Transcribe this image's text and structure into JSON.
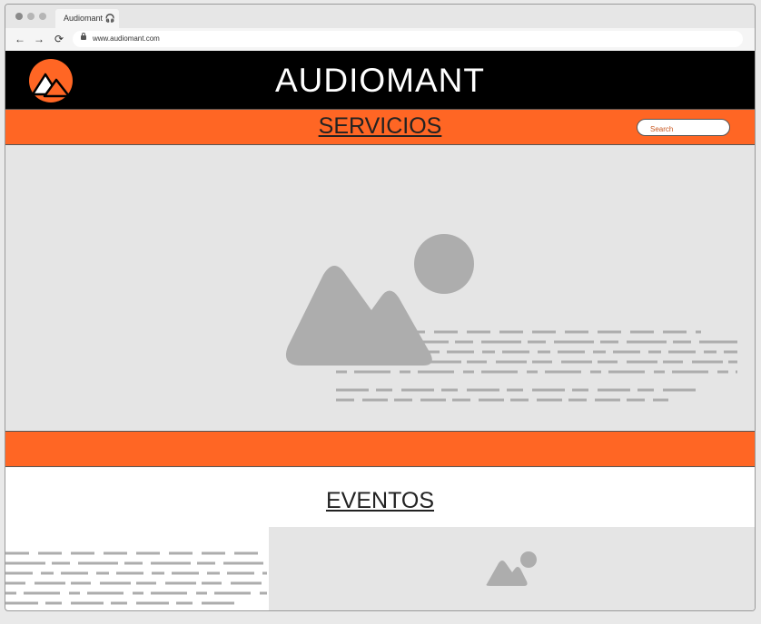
{
  "browser": {
    "tab_title": "Audiomant 🎧",
    "url": "www.audiomant.com",
    "back_label": "←",
    "forward_label": "→",
    "reload_label": "⟳"
  },
  "header": {
    "site_title": "AUDIOMANT",
    "logo_icon": "mountain-logo-icon"
  },
  "navbar": {
    "link_label": "SERVICIOS",
    "search_placeholder": "Search"
  },
  "events": {
    "title": "EVENTOS"
  },
  "colors": {
    "accent": "#ff6624",
    "header_bg": "#000000",
    "placeholder_bg": "#e5e5e5",
    "placeholder_shape": "#adadad"
  }
}
